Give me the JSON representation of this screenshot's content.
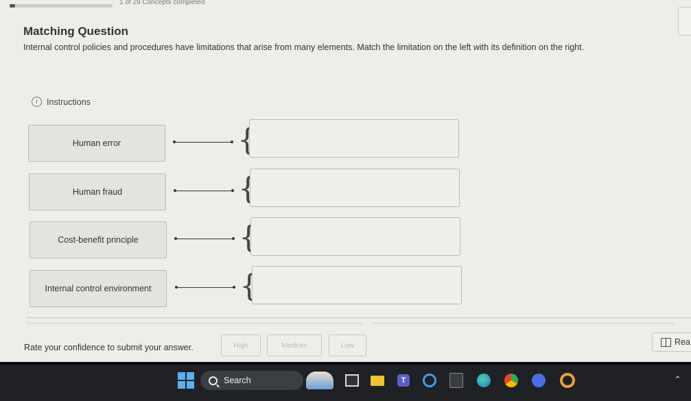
{
  "top": {
    "progress_text": "1 of 29 Concepts completed",
    "progress_fraction": 0.03
  },
  "header": {
    "title": "Matching Question",
    "question": "Internal control policies and procedures have limitations that arise from many elements. Match the limitation on the left with its definition on the right."
  },
  "instructions": {
    "icon": "info-icon",
    "label": "Instructions"
  },
  "matching": {
    "items": [
      {
        "label": "Human error"
      },
      {
        "label": "Human fraud"
      },
      {
        "label": "Cost-benefit principle"
      },
      {
        "label": "Internal control environment"
      }
    ]
  },
  "confidence": {
    "label": "Rate your confidence to submit your answer.",
    "high": "High",
    "medium": "Medium",
    "low": "Low"
  },
  "read_button": {
    "icon": "book-icon",
    "label": "Rea"
  },
  "taskbar": {
    "search_label": "Search",
    "icons": [
      "windows-start-icon",
      "search-icon",
      "weather-widget-icon",
      "task-view-icon",
      "file-explorer-icon",
      "teams-icon",
      "cortana-icon",
      "calculator-icon",
      "edge-icon",
      "chrome-icon",
      "tube-app-icon",
      "opera-icon",
      "chevron-up-icon"
    ]
  },
  "colors": {
    "page_bg": "#ecefe9",
    "term_box_bg": "#e2e5df",
    "taskbar_bg": "#1f2124"
  }
}
